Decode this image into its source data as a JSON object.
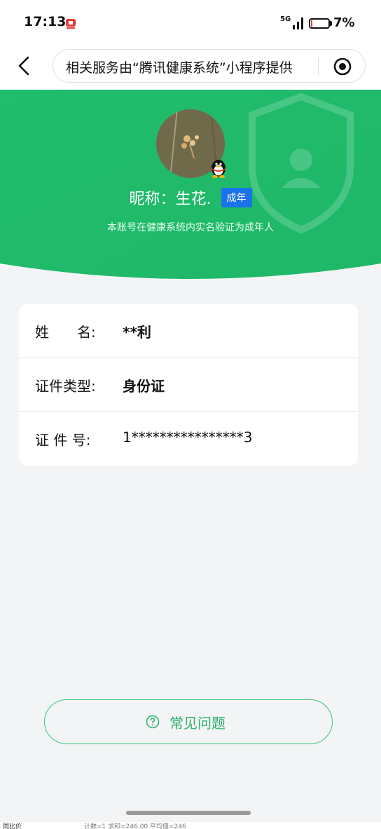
{
  "status_bar": {
    "time": "17:13",
    "network": "5G",
    "battery_percent_text": "7%",
    "battery_level": 0.07
  },
  "nav": {
    "capsule_text": "相关服务由“腾讯健康系统”小程序提供"
  },
  "profile": {
    "nickname": "昵称：生花.",
    "badge": "成年",
    "verify_text": "本账号在健康系统内实名验证为成年人"
  },
  "info": {
    "rows": [
      {
        "label": "姓　　名:",
        "value": "**利"
      },
      {
        "label": "证件类型:",
        "value": "身份证"
      },
      {
        "label": "证  件  号:",
        "value": "1****************3"
      }
    ]
  },
  "faq_label": "常见问题",
  "bottom_bar": {
    "left": "同比价",
    "right": "计数=1   求和=246.00   平均值=246"
  },
  "colors": {
    "hero_green": "#1fba6a",
    "badge_blue": "#1a73e8",
    "faq_green": "#2fb36d"
  }
}
